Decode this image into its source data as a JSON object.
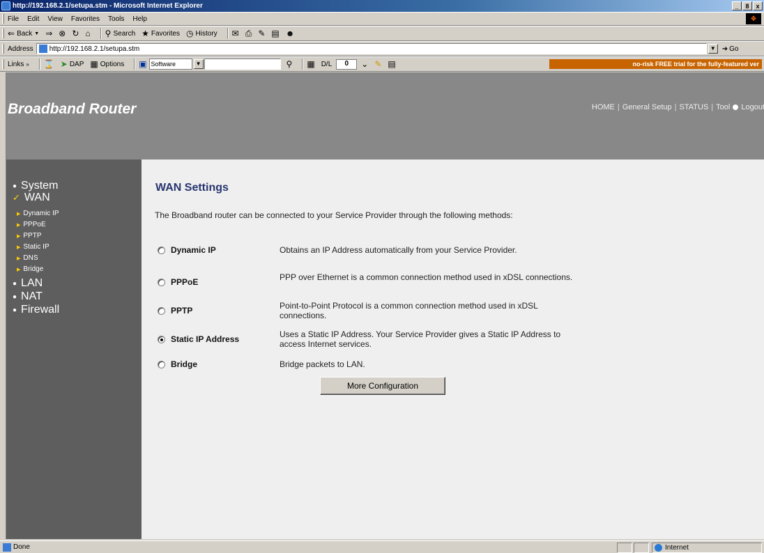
{
  "window": {
    "title": "http://192.168.2.1/setupa.stm - Microsoft Internet Explorer",
    "controls": [
      "_",
      "8",
      "x"
    ]
  },
  "menubar": {
    "items": [
      "File",
      "Edit",
      "View",
      "Favorites",
      "Tools",
      "Help"
    ]
  },
  "toolbar": {
    "back": "Back",
    "search": "Search",
    "favorites": "Favorites",
    "history": "History"
  },
  "addressbar": {
    "label": "Address",
    "url": "http://192.168.2.1/setupa.stm",
    "go": "Go"
  },
  "linksbar": {
    "links": "Links",
    "dap": "DAP",
    "options": "Options",
    "software": "Software",
    "dl_label": "D/L",
    "dl_value": "0",
    "promo": "no-risk FREE trial for the fully-featured ver"
  },
  "header": {
    "brand": "Broadband Router",
    "nav": [
      "HOME",
      "General Setup",
      "STATUS",
      "Tool",
      "Logout"
    ]
  },
  "sidebar": {
    "main": [
      "System",
      "WAN",
      "LAN",
      "NAT",
      "Firewall"
    ],
    "wan_sub": [
      "Dynamic IP",
      "PPPoE",
      "PPTP",
      "Static IP",
      "DNS",
      "Bridge"
    ]
  },
  "content": {
    "heading": "WAN Settings",
    "intro": "The Broadband router can be connected to your Service Provider through the following methods:",
    "options": [
      {
        "label": "Dynamic IP",
        "desc": "Obtains an IP Address automatically from your Service Provider.",
        "checked": false
      },
      {
        "label": "PPPoE",
        "desc": "PPP over Ethernet is a common connection method used in xDSL connections.",
        "checked": false
      },
      {
        "label": "PPTP",
        "desc": "Point-to-Point Protocol is a common connection method used in xDSL connections.",
        "checked": false
      },
      {
        "label": "Static IP Address",
        "desc": "Uses a Static IP Address. Your Service Provider gives a Static IP Address to access Internet services.",
        "checked": true
      },
      {
        "label": "Bridge",
        "desc": "Bridge packets to LAN.",
        "checked": false
      }
    ],
    "button": "More Configuration"
  },
  "statusbar": {
    "status": "Done",
    "zone": "Internet"
  }
}
